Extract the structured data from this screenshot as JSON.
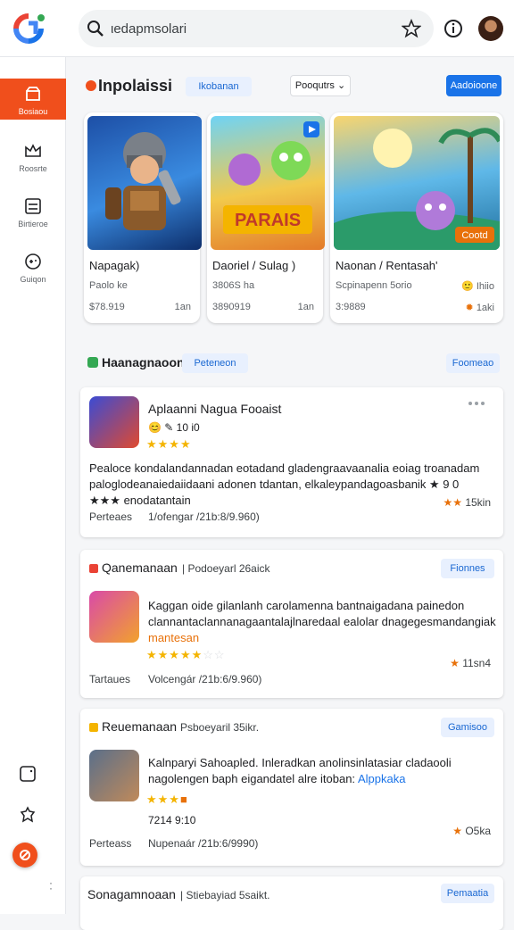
{
  "search": {
    "value": "ιedapmsolari"
  },
  "sidebar": {
    "items": [
      {
        "label": "Bosiaou",
        "icon": "store-icon"
      },
      {
        "label": "Roosrte",
        "icon": "crown-icon"
      },
      {
        "label": "Birtieroe",
        "icon": "list-icon"
      },
      {
        "label": "Guiqon",
        "icon": "gamepad-icon"
      }
    ]
  },
  "header": {
    "title": "Inpolaissi",
    "chip": "Ikobanan",
    "dropdown": "Pooqutrs",
    "button": "Aadoioone"
  },
  "cards": [
    {
      "title": "Napagak)",
      "sub": "Paolo ke",
      "price": "$78.919",
      "rating": "1an"
    },
    {
      "title": "Daoriel / Sulag )",
      "sub": "3806S ha",
      "price": "3890919",
      "rating": "1an"
    },
    {
      "title": "Naonan / Rentasah'",
      "sub": "Scpinapenn 5orio",
      "price": "3:9889",
      "rating": "1aki",
      "rating2": "Ihiio",
      "badge": "Cootd"
    }
  ],
  "section2": {
    "title": "Haanagnaoon",
    "chip": "Peteneon",
    "right_chip": "Foomeao"
  },
  "review1": {
    "app_title": "Aplaanni Nagua Fooaist",
    "meta_line": "😊  ✎  10 i0",
    "text": "Pealoce kondalandannadan eotadand gladengraavaanalia eoiag troanadam paloglodeanaiedaiidaani adonen tdantan, elkaleypandagoasbanik  ★ 9 0 ★★★ enodatantain",
    "left": "Perteaes",
    "middle": "1/ofengar /21b:8/9.960)",
    "rating": "15kin"
  },
  "section3": {
    "title": "Qanemanaan",
    "subtitle": "| Podoeyarl 26aick",
    "chip": "Fionnes",
    "text": "Kaggan oide gilanlanh carolamenna bantnaigadana painedon clannantaclannanagaantalajlnaredaal ealolar dnagegesmandangiak",
    "highlight": "mantesan",
    "left": "Tartaues",
    "middle": "Volcengár /21b:6/9.960)",
    "rating": "11sn4"
  },
  "section4": {
    "title": "Reuemanaan",
    "subtitle": "Psboeyaril 35ikr.",
    "chip": "Gamisoo",
    "text": "Kalnparyi Sahoapled. Inleradkan anolinsinlatasiar cladaooli nagolengen baph eigandatel alre itoban:",
    "link": "Alppkaka",
    "meta_line": "7214 9:10",
    "left": "Perteass",
    "middle": "Nupenaár /21b:6/9990)",
    "rating": "O5ka"
  },
  "section5": {
    "title": "Sonagamnoaan",
    "subtitle": "| Stiebayiad 5saikt.",
    "chip": "Pemaatia"
  },
  "colors": {
    "accent": "#1a73e8",
    "brand": "#f04f1c"
  }
}
